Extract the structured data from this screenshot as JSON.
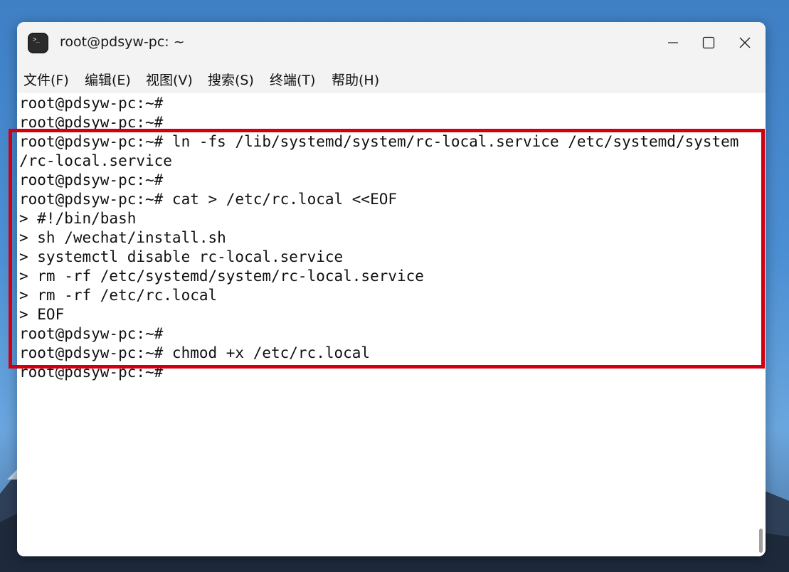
{
  "window": {
    "title": "root@pdsyw-pc: ~",
    "app_icon_glyph": ">_"
  },
  "controls": {
    "minimize_icon": "minimize-icon",
    "maximize_icon": "maximize-icon",
    "close_icon": "close-icon"
  },
  "menu": [
    {
      "label": "文件(F)"
    },
    {
      "label": "编辑(E)"
    },
    {
      "label": "视图(V)"
    },
    {
      "label": "搜索(S)"
    },
    {
      "label": "终端(T)"
    },
    {
      "label": "帮助(H)"
    }
  ],
  "terminal": {
    "lines": [
      "root@pdsyw-pc:~#",
      "root@pdsyw-pc:~#",
      "root@pdsyw-pc:~# ln -fs /lib/systemd/system/rc-local.service /etc/systemd/system",
      "/rc-local.service",
      "root@pdsyw-pc:~#",
      "root@pdsyw-pc:~# cat > /etc/rc.local <<EOF",
      "> #!/bin/bash",
      "> sh /wechat/install.sh",
      "> systemctl disable rc-local.service",
      "> rm -rf /etc/systemd/system/rc-local.service",
      "> rm -rf /etc/rc.local",
      "> EOF",
      "root@pdsyw-pc:~#",
      "root@pdsyw-pc:~# chmod +x /etc/rc.local",
      "root@pdsyw-pc:~#"
    ]
  },
  "colors": {
    "highlight": "#d00012",
    "terminal_bg": "#ffffff",
    "terminal_text": "#111111",
    "titlebar_bg": "#f3f3f3"
  }
}
